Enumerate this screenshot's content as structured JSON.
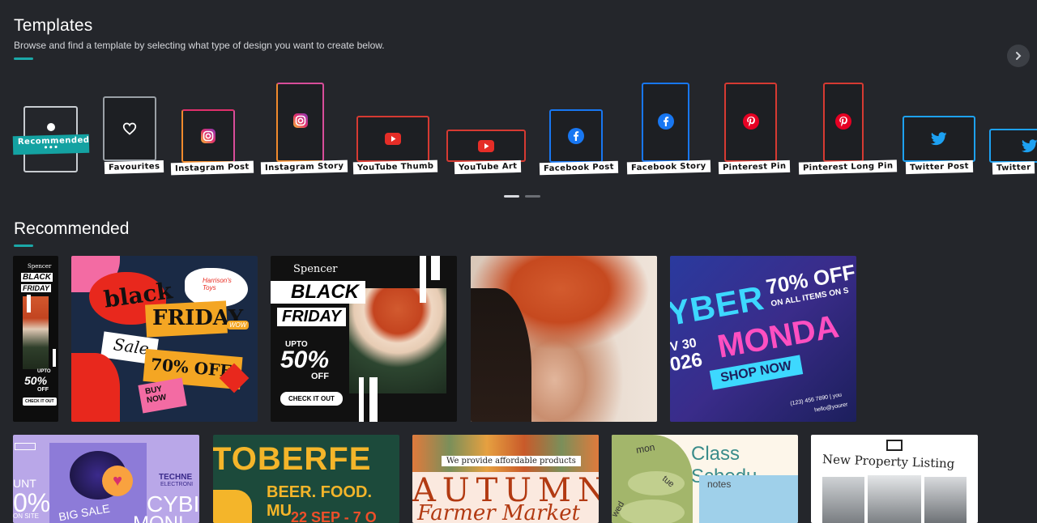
{
  "header": {
    "title": "Templates",
    "subtitle": "Browse and find a template by selecting what type of design you want to create below."
  },
  "templates": [
    {
      "label": "Recommended"
    },
    {
      "label": "Favourites"
    },
    {
      "label": "Instagram Post"
    },
    {
      "label": "Instagram Story"
    },
    {
      "label": "YouTube Thumb"
    },
    {
      "label": "YouTube Art"
    },
    {
      "label": "Facebook Post"
    },
    {
      "label": "Facebook Story"
    },
    {
      "label": "Pinterest Pin"
    },
    {
      "label": "Pinterest Long Pin"
    },
    {
      "label": "Twitter Post"
    },
    {
      "label": "Twitter"
    }
  ],
  "recommended": {
    "title": "Recommended"
  },
  "cards": {
    "c1": {
      "brand": "Spencer",
      "line1": "BLACK",
      "line2": "FRIDAY",
      "upto": "UPTO",
      "pct": "50%",
      "off": "OFF",
      "cta": "CHECK IT OUT"
    },
    "c2": {
      "w1": "black",
      "w2": "FRIDAY",
      "w3": "Sale",
      "w4": "70% OFF",
      "w5": "BUY NOW",
      "brand": "Harrison's Toys",
      "wow": "WOW"
    },
    "c3": {
      "brand": "Spencer",
      "line1": "BLACK",
      "line2": "FRIDAY",
      "upto": "UPTO",
      "pct": "50%",
      "off": "OFF",
      "cta": "CHECK IT OUT"
    },
    "c5": {
      "big1": "YBER",
      "pct": "70% OFF",
      "sub": "ON ALL ITEMS ON S",
      "date1": "V 30",
      "date2": "026",
      "monday": "MONDA",
      "cta": "SHOP NOW",
      "phone": "(123) 456 7890 | you",
      "email": "hello@yourer"
    },
    "c6": {
      "a": "UNT",
      "b": "0%",
      "c": "ON SITE",
      "d": "TECHNE",
      "e": "ELECTRONI",
      "f": "CYBI",
      "g": "MONI",
      "h": "BIG SALE"
    },
    "c7": {
      "a": "TOBERFE",
      "b": "BEER. FOOD. MU",
      "c": "22 SEP - 7 O"
    },
    "c8": {
      "a": "We provide affordable products",
      "b": "AUTUMN",
      "c": "Farmer Market"
    },
    "c9": {
      "a": "Class Schedu",
      "b": "mon",
      "c": "tue",
      "d": "wed",
      "e": "notes"
    },
    "c10": {
      "a": "New Property Listing"
    }
  },
  "colors": {
    "accent": "#1ba8a8",
    "instagram": "#e1306c",
    "youtube": "#e52d27",
    "facebook": "#1877f2",
    "pinterest": "#e60023",
    "twitter": "#1da1f2"
  }
}
